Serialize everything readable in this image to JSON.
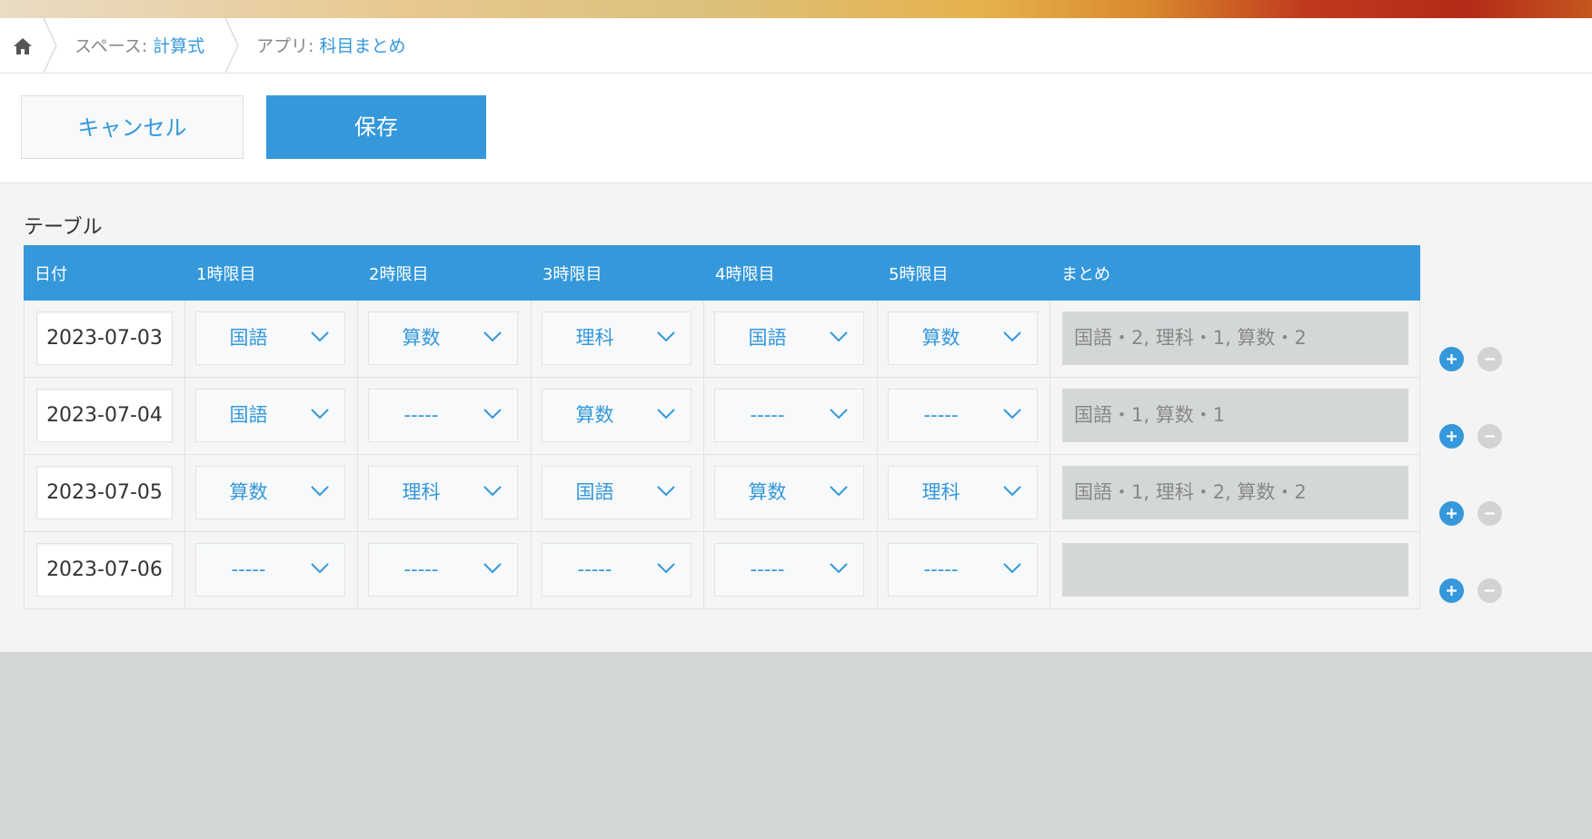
{
  "breadcrumb": {
    "home_icon": "home-icon",
    "space_prefix": "スペース: ",
    "space_name": "計算式",
    "app_prefix": "アプリ: ",
    "app_name": "科目まとめ"
  },
  "toolbar": {
    "cancel_label": "キャンセル",
    "save_label": "保存"
  },
  "table": {
    "label": "テーブル",
    "headers": [
      "日付",
      "1時限目",
      "2時限目",
      "3時限目",
      "4時限目",
      "5時限目",
      "まとめ"
    ],
    "rows": [
      {
        "date": "2023-07-03",
        "periods": [
          "国語",
          "算数",
          "理科",
          "国語",
          "算数"
        ],
        "summary": "国語・2, 理科・1, 算数・2"
      },
      {
        "date": "2023-07-04",
        "periods": [
          "国語",
          "-----",
          "算数",
          "-----",
          "-----"
        ],
        "summary": "国語・1, 算数・1"
      },
      {
        "date": "2023-07-05",
        "periods": [
          "算数",
          "理科",
          "国語",
          "算数",
          "理科"
        ],
        "summary": "国語・1, 理科・2, 算数・2"
      },
      {
        "date": "2023-07-06",
        "periods": [
          "-----",
          "-----",
          "-----",
          "-----",
          "-----"
        ],
        "summary": ""
      }
    ]
  },
  "colors": {
    "accent": "#3498db",
    "header_bg": "#3498db",
    "readonly_bg": "#d4d7d8"
  }
}
